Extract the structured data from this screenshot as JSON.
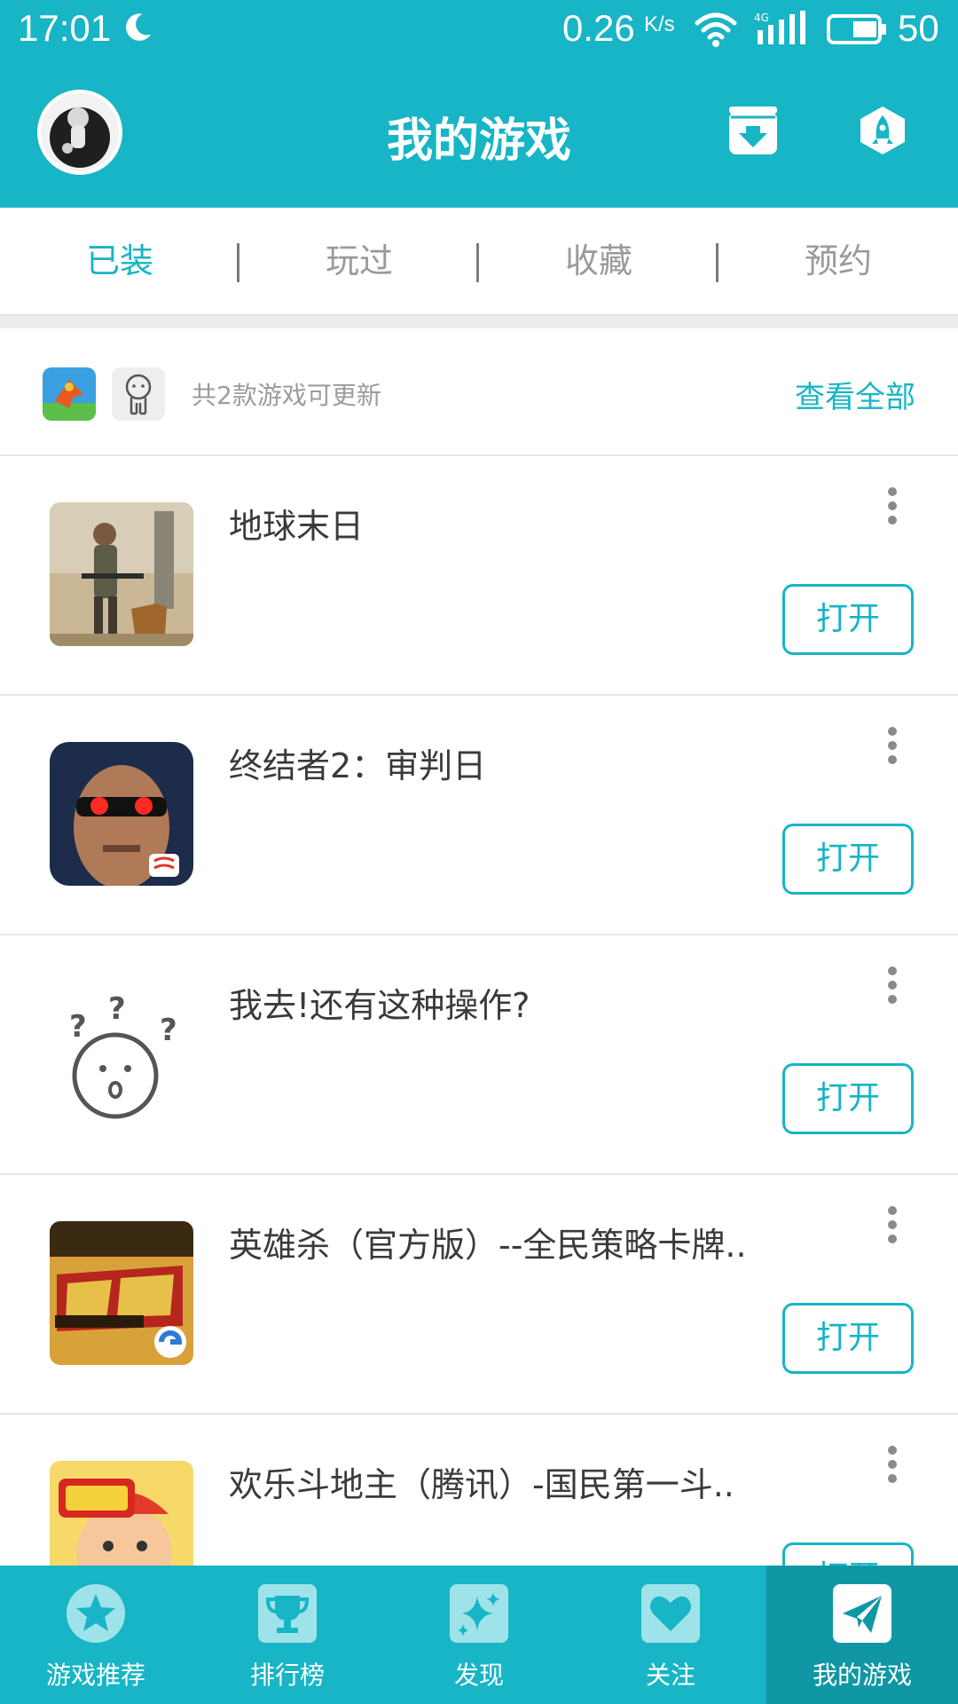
{
  "status_bar": {
    "time": "17:01",
    "speed": "0.26",
    "speed_unit": "K/s",
    "network": "4G",
    "battery": "50"
  },
  "header": {
    "title": "我的游戏"
  },
  "tabs": [
    {
      "label": "已装",
      "active": true
    },
    {
      "label": "玩过",
      "active": false
    },
    {
      "label": "收藏",
      "active": false
    },
    {
      "label": "预约",
      "active": false
    }
  ],
  "update_bar": {
    "text": "共2款游戏可更新",
    "link": "查看全部"
  },
  "games": [
    {
      "name": "地球末日",
      "button": "打开"
    },
    {
      "name": "终结者2：审判日",
      "button": "打开"
    },
    {
      "name": "我去!还有这种操作?",
      "button": "打开"
    },
    {
      "name": "英雄杀（官方版）--全民策略卡牌..",
      "button": "打开"
    },
    {
      "name": "欢乐斗地主（腾讯）-国民第一斗..",
      "button": "打开"
    }
  ],
  "bottom_nav": [
    {
      "label": "游戏推荐",
      "icon": "star-icon",
      "active": false
    },
    {
      "label": "排行榜",
      "icon": "trophy-icon",
      "active": false
    },
    {
      "label": "发现",
      "icon": "sparkle-icon",
      "active": false
    },
    {
      "label": "关注",
      "icon": "heart-icon",
      "active": false
    },
    {
      "label": "我的游戏",
      "icon": "paper-plane-icon",
      "active": true
    }
  ],
  "colors": {
    "accent": "#17b5c5",
    "accent_dark": "#0f97a5"
  }
}
